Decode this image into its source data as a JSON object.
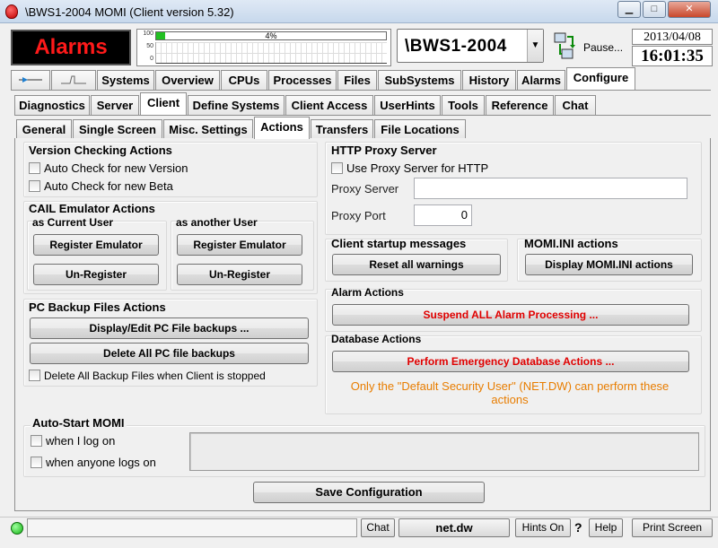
{
  "window": {
    "title": "\\BWS1-2004 MOMI (Client version 5.32)",
    "minimize": "▁",
    "maximize": "□",
    "close": "✕"
  },
  "header": {
    "alarms_label": "Alarms",
    "cpu_axis": [
      "100",
      "50",
      "0"
    ],
    "cpu_percent_text": "4%",
    "cpu_percent": 4,
    "server": "\\BWS1-2004",
    "pause_label": "Pause...",
    "date": "2013/04/08",
    "time": "16:01:35"
  },
  "main_tabs": [
    "Systems",
    "Overview",
    "CPUs",
    "Processes",
    "Files",
    "SubSystems",
    "History",
    "Alarms",
    "Configure"
  ],
  "config_tabs": [
    "Diagnostics",
    "Server",
    "Client",
    "Define Systems",
    "Client Access",
    "UserHints",
    "Tools",
    "Reference",
    "Chat"
  ],
  "client_tabs": [
    "General",
    "Single Screen",
    "Misc. Settings",
    "Actions",
    "Transfers",
    "File Locations"
  ],
  "version": {
    "title": "Version Checking Actions",
    "auto_version": "Auto Check for new Version",
    "auto_beta": "Auto Check for new Beta"
  },
  "cail": {
    "title": "CAIL Emulator Actions",
    "current_user": "as Current User",
    "another_user": "as another User",
    "register": "Register Emulator",
    "unregister": "Un-Register"
  },
  "backup": {
    "title": "PC Backup Files Actions",
    "display_edit": "Display/Edit PC File backups ...",
    "delete_all": "Delete All PC file backups",
    "delete_on_stop": "Delete All Backup Files when Client is stopped"
  },
  "proxy": {
    "title": "HTTP Proxy Server",
    "use_proxy": "Use Proxy Server for HTTP",
    "server_label": "Proxy Server",
    "server_value": "",
    "port_label": "Proxy Port",
    "port_value": "0"
  },
  "startup": {
    "title": "Client startup messages",
    "reset": "Reset all warnings"
  },
  "momi_ini": {
    "title": "MOMI.INI actions",
    "display": "Display MOMI.INI actions"
  },
  "alarm_actions": {
    "title": "Alarm Actions",
    "suspend": "Suspend ALL Alarm Processing ..."
  },
  "database": {
    "title": "Database Actions",
    "emergency": "Perform Emergency Database Actions ...",
    "note": "Only the \"Default Security User\" (NET.DW) can perform these actions"
  },
  "autostart": {
    "title": "Auto-Start MOMI",
    "when_i": "when I log on",
    "when_anyone": "when anyone logs on"
  },
  "save_label": "Save Configuration",
  "statusbar": {
    "chat": "Chat",
    "user": "net.dw",
    "hints": "Hints On",
    "question": "?",
    "help": "Help",
    "print": "Print Screen"
  },
  "colors": {
    "alarm_red": "#ff1a1a",
    "warning_red": "#e00000",
    "note_orange": "#e87d00",
    "status_green": "#15b515"
  }
}
